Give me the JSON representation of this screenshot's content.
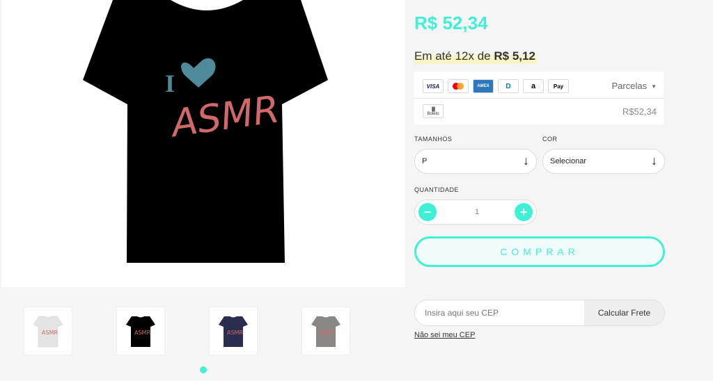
{
  "product": {
    "image_alt": "Camiseta preta I love ASMR",
    "print_text": "I ♥ ASMR",
    "thumbnails": [
      {
        "name": "white-shirt",
        "color": "#e4e4e4"
      },
      {
        "name": "black-shirt",
        "color": "#000000"
      },
      {
        "name": "navy-shirt",
        "color": "#2b2d4e"
      },
      {
        "name": "gray-shirt",
        "color": "#8a8684"
      }
    ]
  },
  "price": {
    "main": "R$ 52,34",
    "installment_prefix": "Em até 12x de",
    "installment_value": "R$ 5,12"
  },
  "payment": {
    "cards": [
      {
        "name": "visa-icon",
        "label": "VISA",
        "color": "#1a1f71"
      },
      {
        "name": "mastercard-icon",
        "label": "",
        "color": "#eb001b"
      },
      {
        "name": "amex-icon",
        "label": "AMEX",
        "color": "#2e77bc"
      },
      {
        "name": "diners-icon",
        "label": "D",
        "color": "#0079be"
      },
      {
        "name": "amazon-icon",
        "label": "a",
        "color": "#000000"
      },
      {
        "name": "applepay-icon",
        "label": " Pay",
        "color": "#000000"
      }
    ],
    "parcelas_label": "Parcelas",
    "boleto_label": "Boleto",
    "boleto_price": "R$52,34"
  },
  "options": {
    "size_label": "TAMANHOS",
    "size_value": "P",
    "color_label": "COR",
    "color_value": "Selecionar",
    "qty_label": "QUANTIDADE",
    "qty_value": "1"
  },
  "buy_label": "COMPRAR",
  "shipping": {
    "cep_placeholder": "Insira aqui seu CEP",
    "calc_label": "Calcular Frete",
    "unknown_cep": "Não sei meu CEP"
  },
  "colors": {
    "accent": "#3ef0d6",
    "highlight": "#f8f4c6"
  }
}
